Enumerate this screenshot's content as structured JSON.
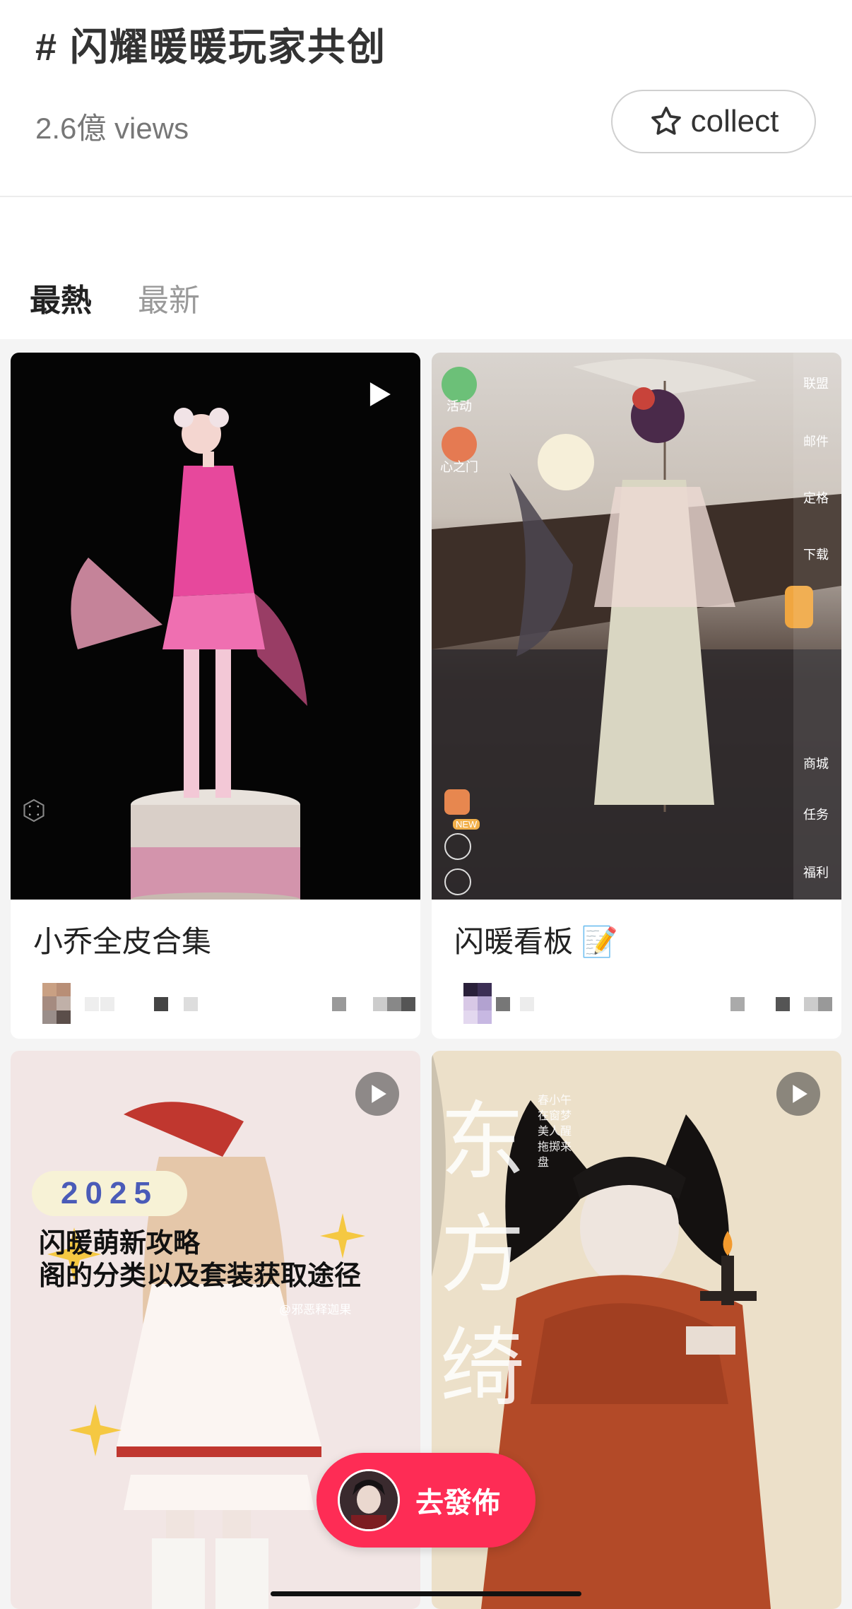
{
  "topic": {
    "title": "# 闪耀暖暖玩家共创",
    "views": "2.6億 views",
    "collect_label": "collect"
  },
  "tabs": [
    {
      "label": "最熱",
      "active": true
    },
    {
      "label": "最新",
      "active": false
    }
  ],
  "cards": [
    {
      "title": "小乔全皮合集",
      "media": "video",
      "icon": "play-icon"
    },
    {
      "title": "闪暖看板 📝",
      "media": "image",
      "game_menu_left": [
        "活动",
        "心之门"
      ],
      "game_menu_right": [
        "联盟",
        "邮件",
        "定格",
        "下载",
        "商城",
        "任务",
        "福利"
      ],
      "new_badge": "NEW"
    },
    {
      "title": "",
      "media": "video",
      "icon": "play-circle-icon",
      "poster": {
        "year": "2025",
        "line1": "闪暖萌新攻略",
        "line2": "阁的分类以及套装获取途径",
        "credit": "@邪恶释迦果"
      }
    },
    {
      "title": "",
      "media": "video",
      "icon": "play-circle-icon",
      "poster": {
        "big_chars": [
          "东",
          "方",
          "绮"
        ],
        "poem": [
          "春小午",
          "在窗梦",
          "美人醒",
          "拖掷来",
          "盘"
        ]
      }
    }
  ],
  "fab": {
    "label": "去發佈"
  },
  "colors": {
    "accent": "#fe2c55",
    "tab_active": "#222222",
    "tab_inactive": "#999999"
  }
}
